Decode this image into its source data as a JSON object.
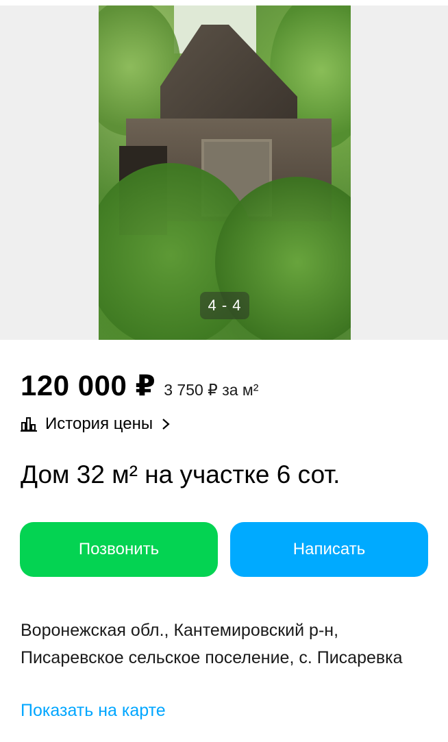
{
  "gallery": {
    "counter": "4 - 4"
  },
  "listing": {
    "price": "120 000 ₽",
    "price_per_m2": "3 750 ₽ за м²",
    "price_history_label": "История цены",
    "title": "Дом 32 м² на участке 6 сот.",
    "address": "Воронежская обл., Кантемировский р-н, Писаревское сельское поселение, с. Писаревка",
    "show_on_map": "Показать на карте"
  },
  "actions": {
    "call_label": "Позвонить",
    "write_label": "Написать"
  },
  "colors": {
    "call_button": "#04d352",
    "write_button": "#00aaff",
    "link": "#00a6ff"
  },
  "icons": {
    "price_history": "bar-chart-icon",
    "chevron": "chevron-right-icon"
  }
}
